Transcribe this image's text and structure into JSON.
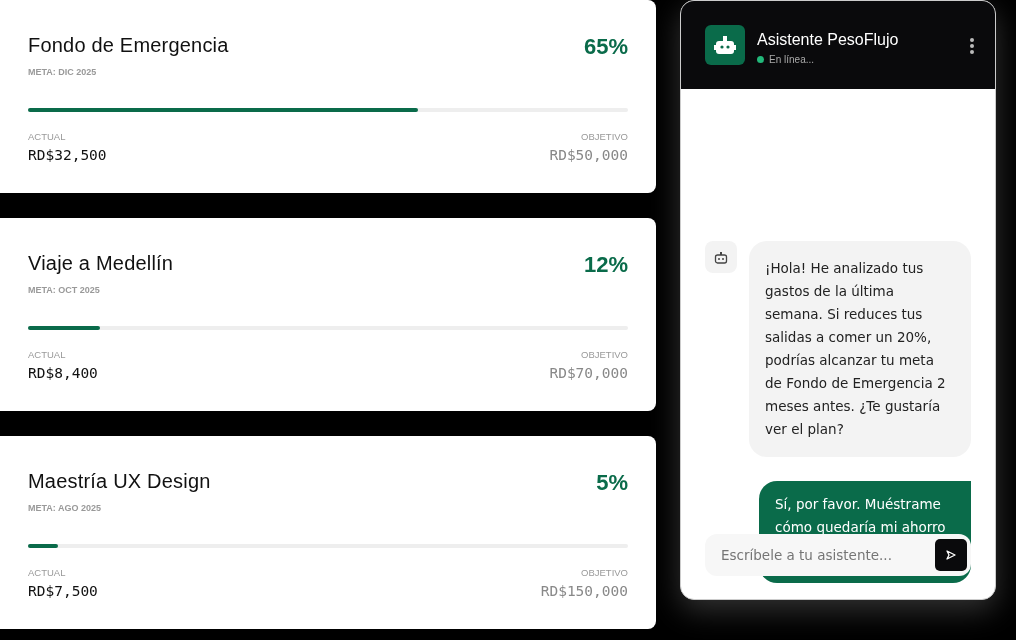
{
  "goals": [
    {
      "title": "Fondo de Emergencia",
      "deadline": "META: DIC 2025",
      "percent": "65%",
      "level": 0.65,
      "current_label": "ACTUAL",
      "current": "RD$32,500",
      "target_label": "OBJETIVO",
      "target": "RD$50,000"
    },
    {
      "title": "Viaje a Medellín",
      "deadline": "META: OCT 2025",
      "percent": "12%",
      "level": 0.12,
      "current_label": "ACTUAL",
      "current": "RD$8,400",
      "target_label": "OBJETIVO",
      "target": "RD$70,000"
    },
    {
      "title": "Maestría UX Design",
      "deadline": "META: AGO 2025",
      "percent": "5%",
      "level": 0.05,
      "current_label": "ACTUAL",
      "current": "RD$7,500",
      "target_label": "OBJETIVO",
      "target": "RD$150,000"
    }
  ],
  "chat": {
    "title": "Asistente PesoFlujo",
    "status": "En línea...",
    "online": true,
    "messages": [
      {
        "kind": "bot",
        "text": "¡Hola! He analizado tus gastos de la última semana. Si reduces tus salidas a comer un 20%, podrías alcanzar tu meta de Fondo de Emergencia 2 meses antes. ¿Te gustaría ver el plan?"
      },
      {
        "kind": "user",
        "text": "Sí, por favor. Muéstrame cómo quedaría mi ahorro"
      }
    ],
    "input": {
      "placeholder": "Escríbele a tu asistente..."
    }
  }
}
